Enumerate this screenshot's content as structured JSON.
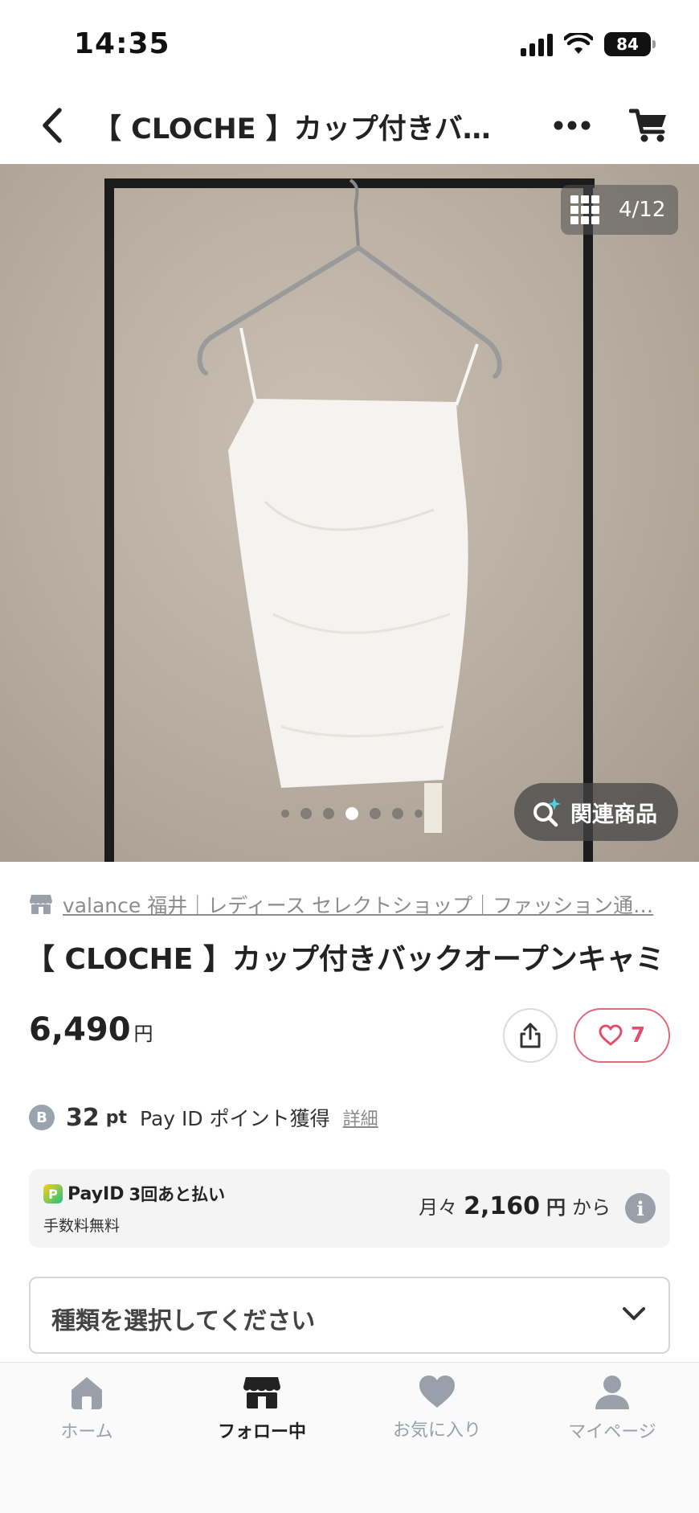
{
  "status_bar": {
    "time": "14:35",
    "battery": "84"
  },
  "header": {
    "title": "【 CLOCHE 】カップ付きバッ…"
  },
  "gallery": {
    "counter": "4/12",
    "related_label": "関連商品",
    "dot_count": 7,
    "active_index": 3
  },
  "shop": {
    "name": "valance 福井｜レディース セレクトショップ｜ファッション通…"
  },
  "product": {
    "title": "【 CLOCHE 】カップ付きバックオープンキャミ",
    "price": "6,490",
    "price_unit": "円",
    "likes": "7"
  },
  "points": {
    "coin_letter": "B",
    "amount": "32",
    "unit": "pt",
    "text": "Pay ID ポイント獲得",
    "detail_link": "詳細"
  },
  "payid": {
    "mark": "P",
    "brand": "PayID",
    "plan": "3回あと払い",
    "fee": "手数料無料",
    "monthly_prefix": "月々",
    "monthly_amount": "2,160",
    "monthly_yen": "円",
    "monthly_suffix": "から",
    "info": "i"
  },
  "variant": {
    "placeholder": "種類を選択してください"
  },
  "tabbar": {
    "tabs": [
      {
        "label": "ホーム"
      },
      {
        "label": "フォロー中"
      },
      {
        "label": "お気に入り"
      },
      {
        "label": "マイページ"
      }
    ]
  },
  "colors": {
    "accent_like": "#e0506a",
    "tab_inactive": "#9aa0aa",
    "text_main": "#222222"
  }
}
